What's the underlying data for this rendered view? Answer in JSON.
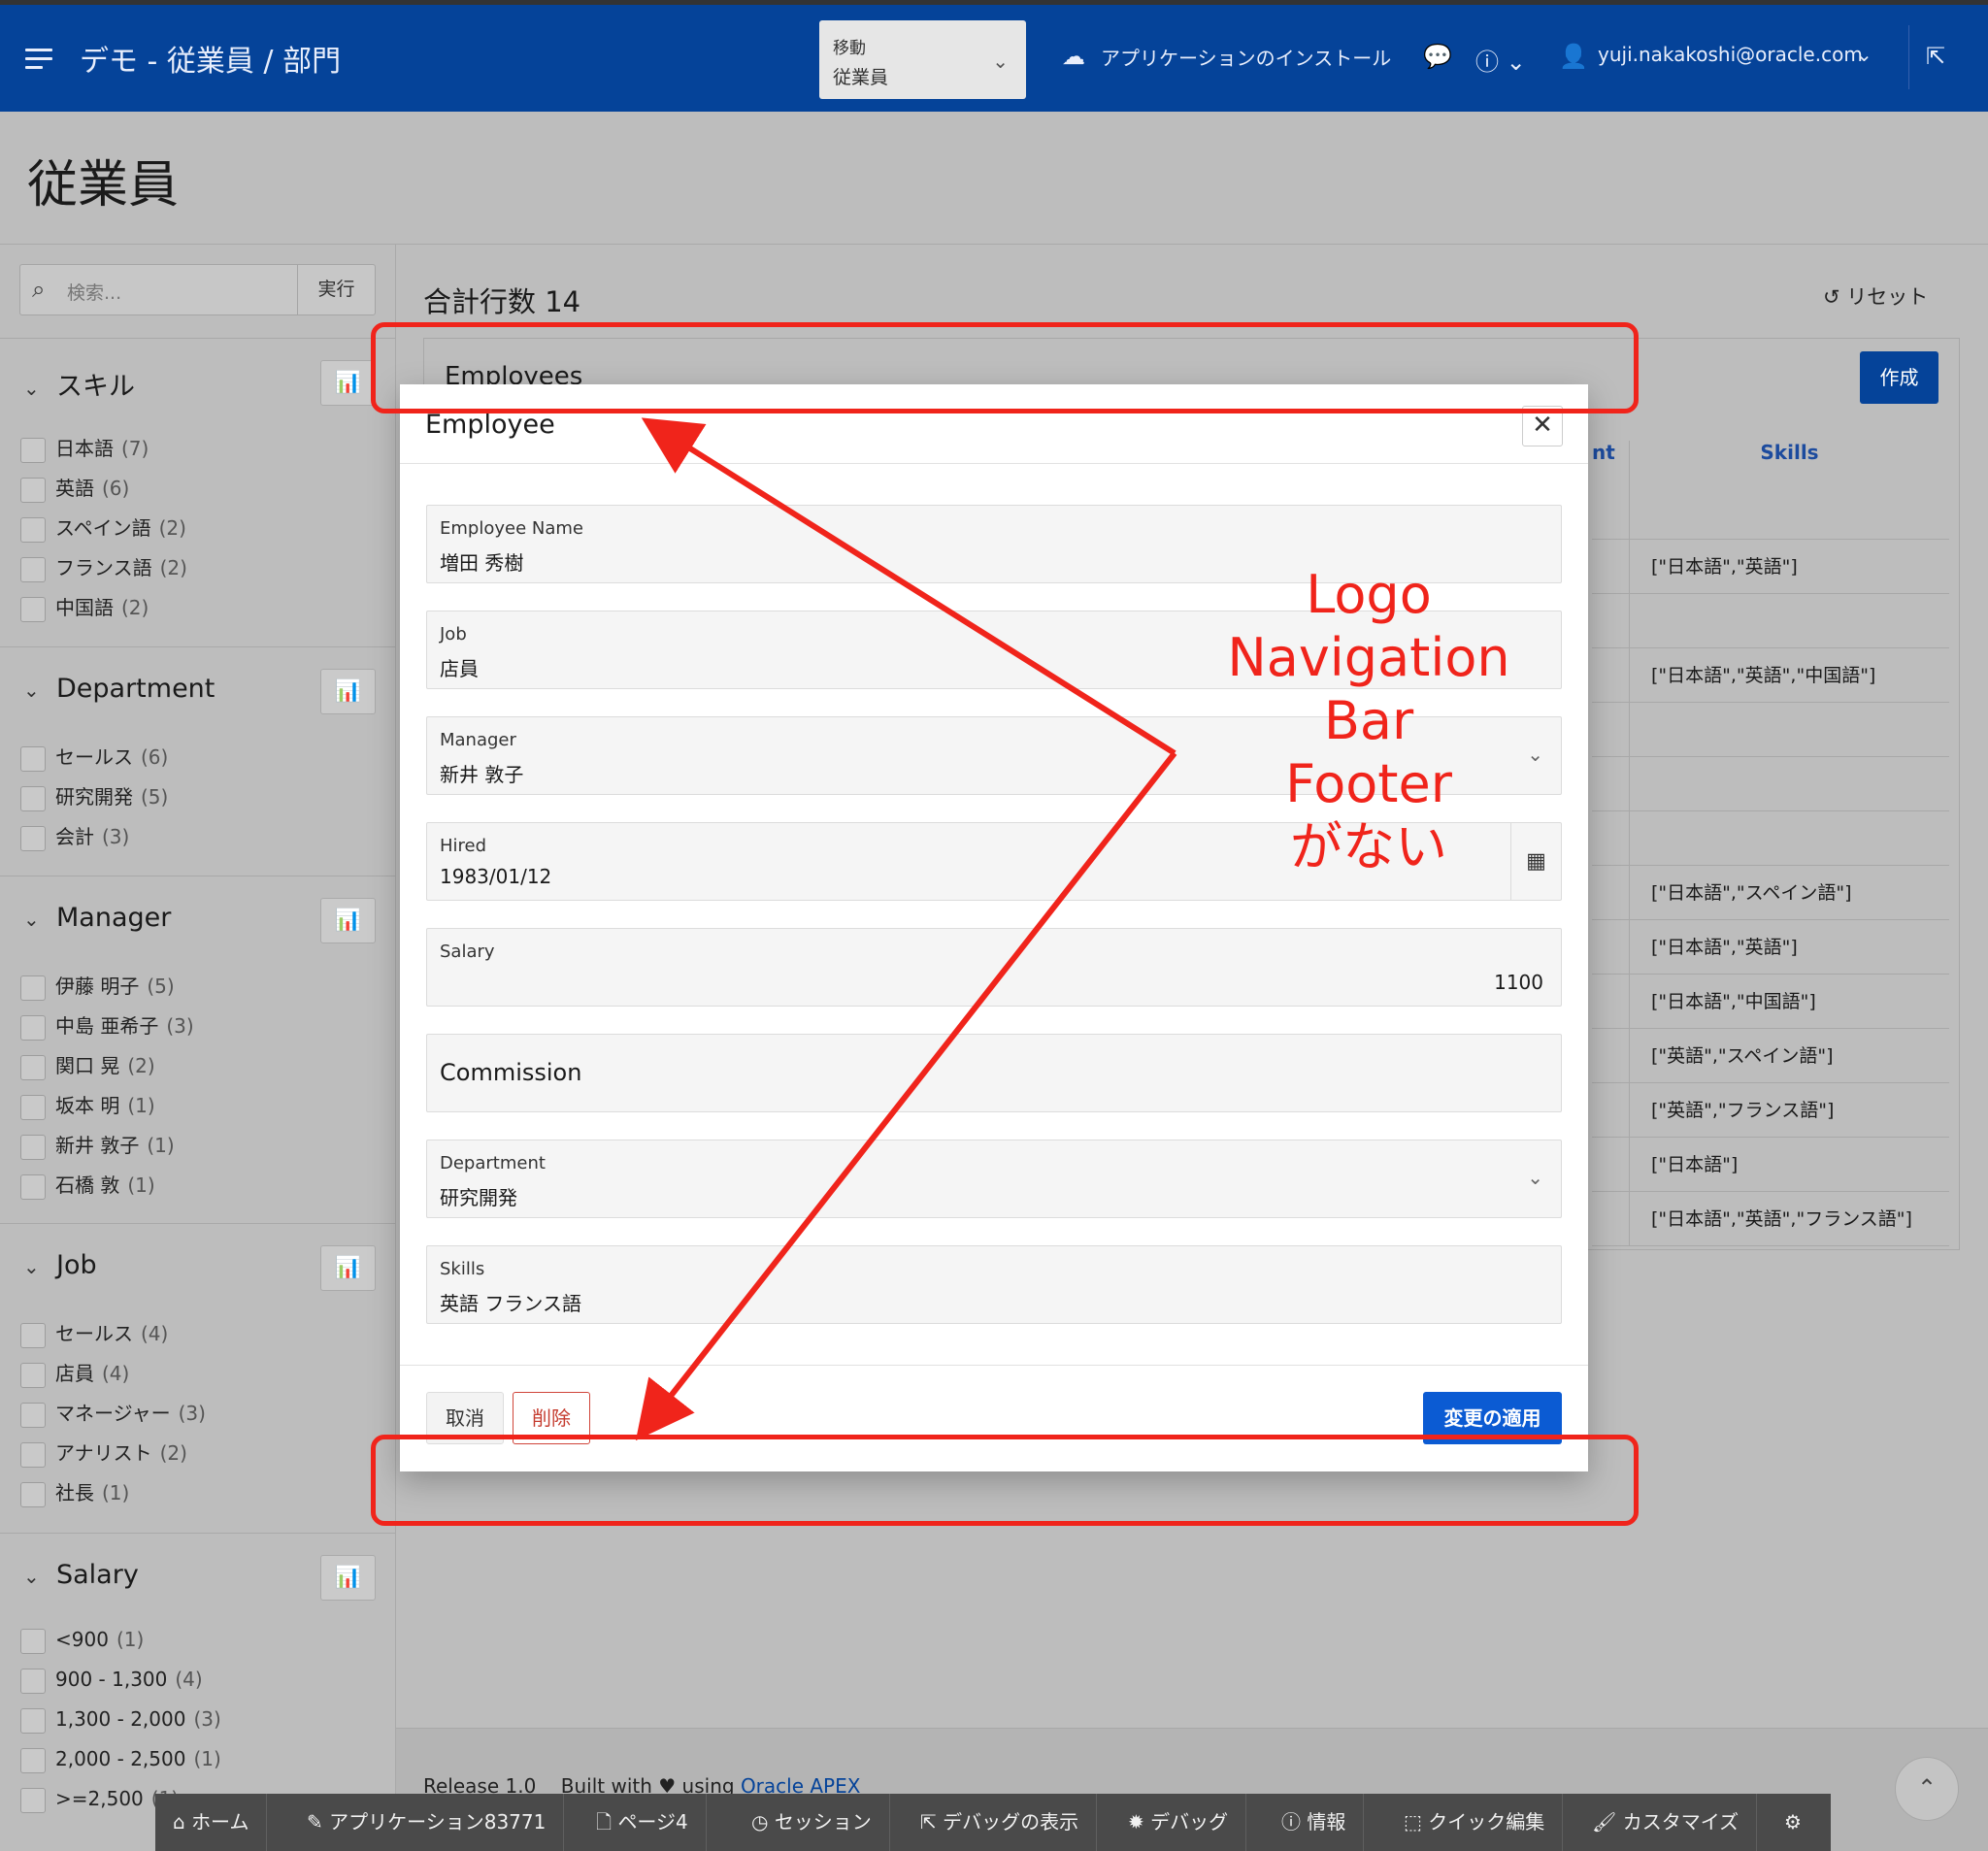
{
  "header": {
    "app_title": "デモ - 従業員 / 部門",
    "nav_label": "移動",
    "nav_value": "従業員",
    "install_app": "アプリケーションのインストール",
    "user": "yuji.nakakoshi@oracle.com",
    "brand_color": "#054399"
  },
  "page": {
    "title": "従業員"
  },
  "search": {
    "placeholder": "検索...",
    "go_label": "実行"
  },
  "facets": [
    {
      "title": "スキル",
      "items": [
        {
          "label": "日本語",
          "count": "(7)"
        },
        {
          "label": "英語",
          "count": "(6)"
        },
        {
          "label": "スペイン語",
          "count": "(2)"
        },
        {
          "label": "フランス語",
          "count": "(2)"
        },
        {
          "label": "中国語",
          "count": "(2)"
        }
      ]
    },
    {
      "title": "Department",
      "items": [
        {
          "label": "セールス",
          "count": "(6)"
        },
        {
          "label": "研究開発",
          "count": "(5)"
        },
        {
          "label": "会計",
          "count": "(3)"
        }
      ]
    },
    {
      "title": "Manager",
      "items": [
        {
          "label": "伊藤 明子",
          "count": "(5)"
        },
        {
          "label": "中島 亜希子",
          "count": "(3)"
        },
        {
          "label": "関口 晃",
          "count": "(2)"
        },
        {
          "label": "坂本 明",
          "count": "(1)"
        },
        {
          "label": "新井 敦子",
          "count": "(1)"
        },
        {
          "label": "石橋 敦",
          "count": "(1)"
        }
      ]
    },
    {
      "title": "Job",
      "items": [
        {
          "label": "セールス",
          "count": "(4)"
        },
        {
          "label": "店員",
          "count": "(4)"
        },
        {
          "label": "マネージャー",
          "count": "(3)"
        },
        {
          "label": "アナリスト",
          "count": "(2)"
        },
        {
          "label": "社長",
          "count": "(1)"
        }
      ]
    },
    {
      "title": "Salary",
      "items": [
        {
          "label": "<900",
          "count": "(1)"
        },
        {
          "label": "900 - 1,300",
          "count": "(4)"
        },
        {
          "label": "1,300 - 2,000",
          "count": "(3)"
        },
        {
          "label": "2,000 - 2,500",
          "count": "(1)"
        },
        {
          "label": ">=2,500",
          "count": "(1)"
        }
      ]
    }
  ],
  "main": {
    "total_rows": "合計行数 14",
    "reset": "リセット",
    "region_title": "Employees",
    "create": "作成",
    "col_partial": "nt",
    "col_skills": "Skills",
    "skills_rows": [
      "",
      "[\"日本語\",\"英語\"]",
      "",
      "[\"日本語\",\"英語\",\"中国語\"]",
      "",
      "",
      "",
      "[\"日本語\",\"スペイン語\"]",
      "[\"日本語\",\"英語\"]",
      "[\"日本語\",\"中国語\"]",
      "[\"英語\",\"スペイン語\"]",
      "[\"英語\",\"フランス語\"]",
      "[\"日本語\"]",
      "[\"日本語\",\"英語\",\"フランス語\"]"
    ]
  },
  "modal": {
    "title": "Employee",
    "fields": {
      "name_label": "Employee Name",
      "name_value": "増田 秀樹",
      "job_label": "Job",
      "job_value": "店員",
      "manager_label": "Manager",
      "manager_value": "新井 敦子",
      "hired_label": "Hired",
      "hired_value": "1983/01/12",
      "salary_label": "Salary",
      "salary_value": "1100",
      "commission_label": "Commission",
      "dept_label": "Department",
      "dept_value": "研究開発",
      "skills_label": "Skills",
      "skills_value": "英語 フランス語"
    },
    "cancel": "取消",
    "delete": "削除",
    "apply": "変更の適用"
  },
  "footer": {
    "release": "Release 1.0",
    "built_with": "Built with",
    "using": "using",
    "apex": "Oracle APEX"
  },
  "devbar": [
    {
      "icon": "home-icon",
      "label": "ホーム"
    },
    {
      "icon": "edit-icon",
      "label": "アプリケーション83771"
    },
    {
      "icon": "page-icon",
      "label": "ページ4"
    },
    {
      "icon": "session-icon",
      "label": "セッション"
    },
    {
      "icon": "debug-view-icon",
      "label": "デバッグの表示"
    },
    {
      "icon": "bug-icon",
      "label": "デバッグ"
    },
    {
      "icon": "info-icon",
      "label": "情報"
    },
    {
      "icon": "quick-edit-icon",
      "label": "クイック編集"
    },
    {
      "icon": "customize-icon",
      "label": "カスタマイズ"
    },
    {
      "icon": "gear-icon",
      "label": ""
    }
  ],
  "annotation": {
    "line1": "Logo",
    "line2": "Navigation Bar",
    "line3": "Footer",
    "line4": "がない",
    "color": "#f0241b"
  }
}
